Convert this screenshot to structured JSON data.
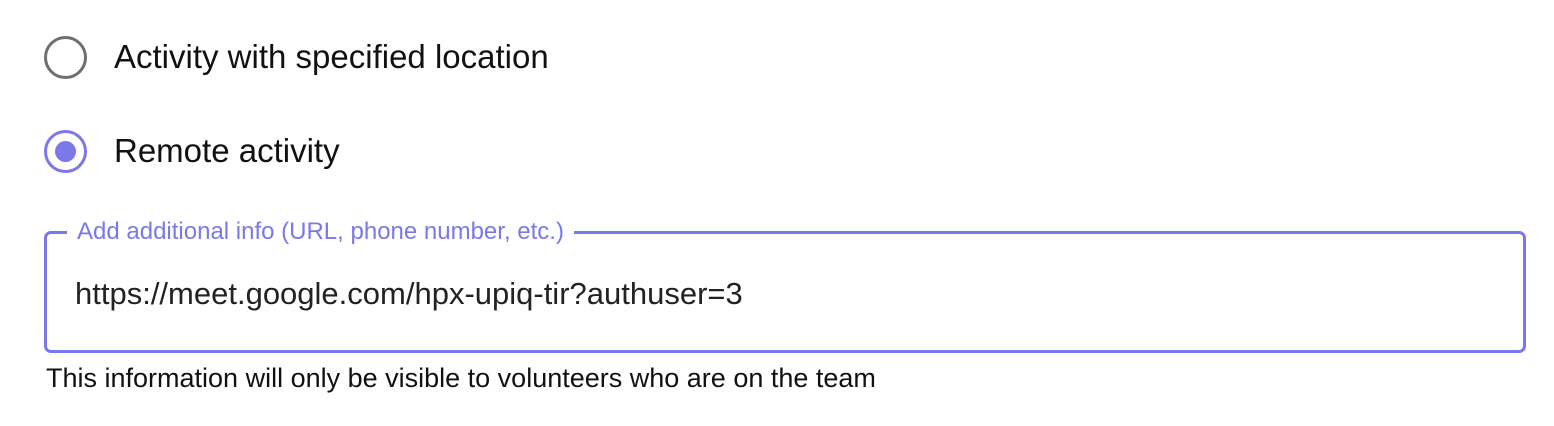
{
  "location_type": {
    "options": [
      {
        "label": "Activity with specified location",
        "selected": false
      },
      {
        "label": "Remote activity",
        "selected": true
      }
    ]
  },
  "additional_info": {
    "label": "Add additional info (URL, phone number, etc.)",
    "value": "https://meet.google.com/hpx-upiq-tir?authuser=3",
    "helper_text": "This information will only be visible to volunteers who are on the team"
  },
  "colors": {
    "accent": "#7b78ea",
    "unselected_radio": "#6f6f6f",
    "text": "#111111"
  }
}
